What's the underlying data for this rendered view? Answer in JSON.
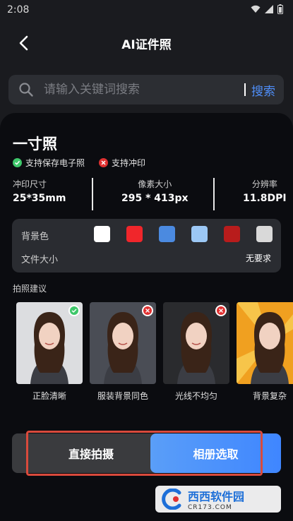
{
  "status_bar": {
    "time": "2:08"
  },
  "header": {
    "title": "AI证件照"
  },
  "search": {
    "placeholder": "请输入关键词搜索",
    "button_label": "搜索"
  },
  "spec_card": {
    "title": "一寸照",
    "features": [
      {
        "label": "支持保存电子照",
        "supported": true,
        "color": "#3ec76a"
      },
      {
        "label": "支持冲印",
        "supported": false,
        "color": "#e03131"
      }
    ],
    "print_size": {
      "label": "冲印尺寸",
      "value": "25*35mm"
    },
    "pixel_size": {
      "label": "像素大小",
      "value": "295 * 413px"
    },
    "resolution": {
      "label": "分辨率",
      "value": "11.8DPI"
    }
  },
  "options": {
    "bg_color_label": "背景色",
    "bg_colors": [
      "#ffffff",
      "#f0262b",
      "#4b8ae0",
      "#9cc8f5",
      "#b81c1c",
      "#d9d9d9"
    ],
    "file_size_label": "文件大小",
    "file_size_value": "无要求"
  },
  "tips": {
    "label": "拍照建议",
    "items": [
      {
        "caption": "正脸清晰",
        "status": "ok",
        "background": "#dcdde0"
      },
      {
        "caption": "服装背景同色",
        "status": "bad",
        "background": "#4a4d55"
      },
      {
        "caption": "光线不均匀",
        "status": "bad",
        "background": "#2a2b2e"
      },
      {
        "caption": "背景复杂",
        "status": "none",
        "background": "#f0a020"
      }
    ]
  },
  "actions": {
    "shoot_label": "直接拍摄",
    "album_label": "相册选取"
  },
  "watermark": {
    "main": "西西软件园",
    "sub": "CR173.COM"
  }
}
